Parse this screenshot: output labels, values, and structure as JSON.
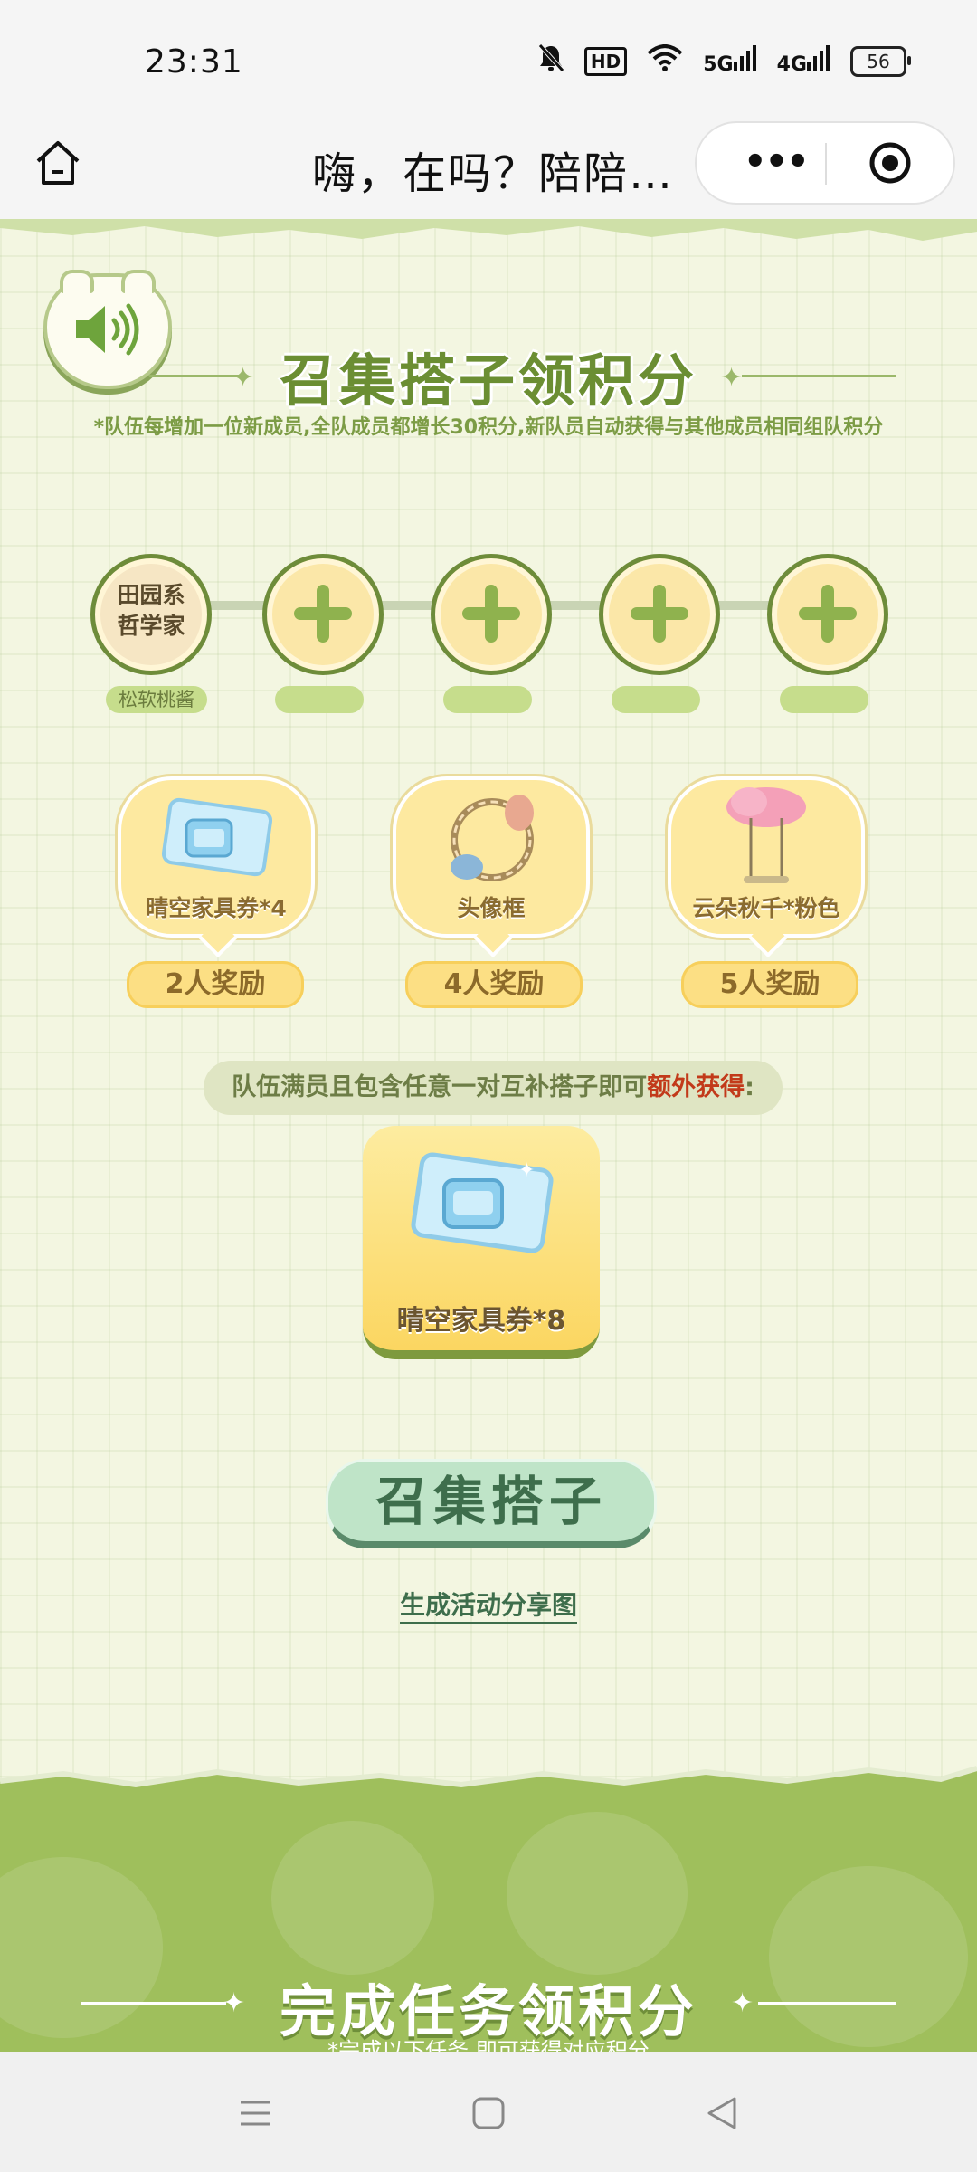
{
  "status_bar": {
    "time": "23:31",
    "hd_label": "HD",
    "net1": "5G",
    "net2": "4G",
    "battery": "56",
    "icons": [
      "mute-icon",
      "hd-icon",
      "wifi-icon",
      "signal-5g-icon",
      "signal-4g-icon",
      "battery-icon"
    ]
  },
  "nav": {
    "title": "嗨，在吗？陪陪…",
    "more_label": "•••",
    "icons": [
      "home-icon",
      "more-icon",
      "close-miniapp-icon"
    ]
  },
  "team": {
    "title": "召集搭子领积分",
    "subtitle": "*队伍每增加一位新成员,全队成员都增长30积分,新队员自动获得与其他成员相同组队积分",
    "first_member_title": "田园系\n哲学家",
    "first_member_name": "松软桃酱",
    "slots": [
      "member",
      "empty",
      "empty",
      "empty",
      "empty"
    ]
  },
  "rewards": [
    {
      "label": "晴空家具券*4",
      "badge": "2人奖励"
    },
    {
      "label": "头像框",
      "badge": "4人奖励"
    },
    {
      "label": "云朵秋千*粉色",
      "badge": "5人奖励"
    }
  ],
  "bonus": {
    "prefix": "队伍满员且包含任意一对互补搭子即可",
    "highlight": "额外获得",
    "suffix": ":",
    "reward_label": "晴空家具券*8"
  },
  "actions": {
    "cta": "召集搭子",
    "share": "生成活动分享图"
  },
  "tasks": {
    "title": "完成任务领积分",
    "subtitle": "*完成以下任务,即可获得对应积分"
  },
  "colors": {
    "accent_green": "#6b8e33",
    "highlight_red": "#c23a1a",
    "reward_yellow": "#fde9a0",
    "section_green": "#9fbf5c"
  }
}
